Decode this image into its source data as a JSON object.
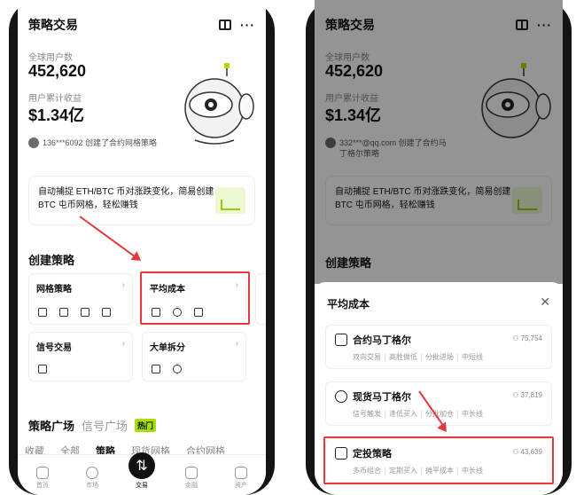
{
  "left": {
    "title": "策略交易",
    "stats": {
      "users_label": "全球用户数",
      "users_value": "452,620",
      "earn_label": "用户累计收益",
      "earn_value": "$1.34亿"
    },
    "activity": "136***6092 创建了合约网格策略",
    "promo": "自动捕捉 ETH/BTC 币对涨跌变化，简易创建 BTC 屯币网格，轻松赚钱",
    "create_title": "创建策略",
    "cards": [
      {
        "title": "网格策略"
      },
      {
        "title": "平均成本"
      },
      {
        "title": "信号交易"
      },
      {
        "title": "大单拆分"
      }
    ],
    "plaza": {
      "title": "策略广场",
      "sub": "信号广场",
      "hot": "热门",
      "tabs": [
        "收藏",
        "全部",
        "策略",
        "现货网格",
        "合约网格"
      ]
    },
    "nav": [
      "首页",
      "市场",
      "交易",
      "金融",
      "资产"
    ]
  },
  "right": {
    "title": "策略交易",
    "stats": {
      "users_label": "全球用户数",
      "users_value": "452,620",
      "earn_label": "用户累计收益",
      "earn_value": "$1.34亿"
    },
    "activity": "332***@qq.com 创建了合约马丁格尔策略",
    "promo": "自动捕捉 ETH/BTC 币对涨跌变化，简易创建 BTC 屯币网格，轻松赚钱",
    "create_title": "创建策略",
    "sheet": {
      "title": "平均成本",
      "options": [
        {
          "title": "合约马丁格尔",
          "count": "75,754",
          "tags": [
            "双向交易",
            "高胜做低",
            "分批进场",
            "中短线"
          ]
        },
        {
          "title": "现货马丁格尔",
          "count": "37,819",
          "tags": [
            "信号触发",
            "逢低买入",
            "分批加仓",
            "中长线"
          ]
        },
        {
          "title": "定投策略",
          "count": "43,639",
          "tags": [
            "多币组合",
            "定期买入",
            "摊平成本",
            "中长线"
          ]
        }
      ]
    }
  },
  "colors": {
    "accent": "#a5e000",
    "highlight": "#e23b3b"
  }
}
